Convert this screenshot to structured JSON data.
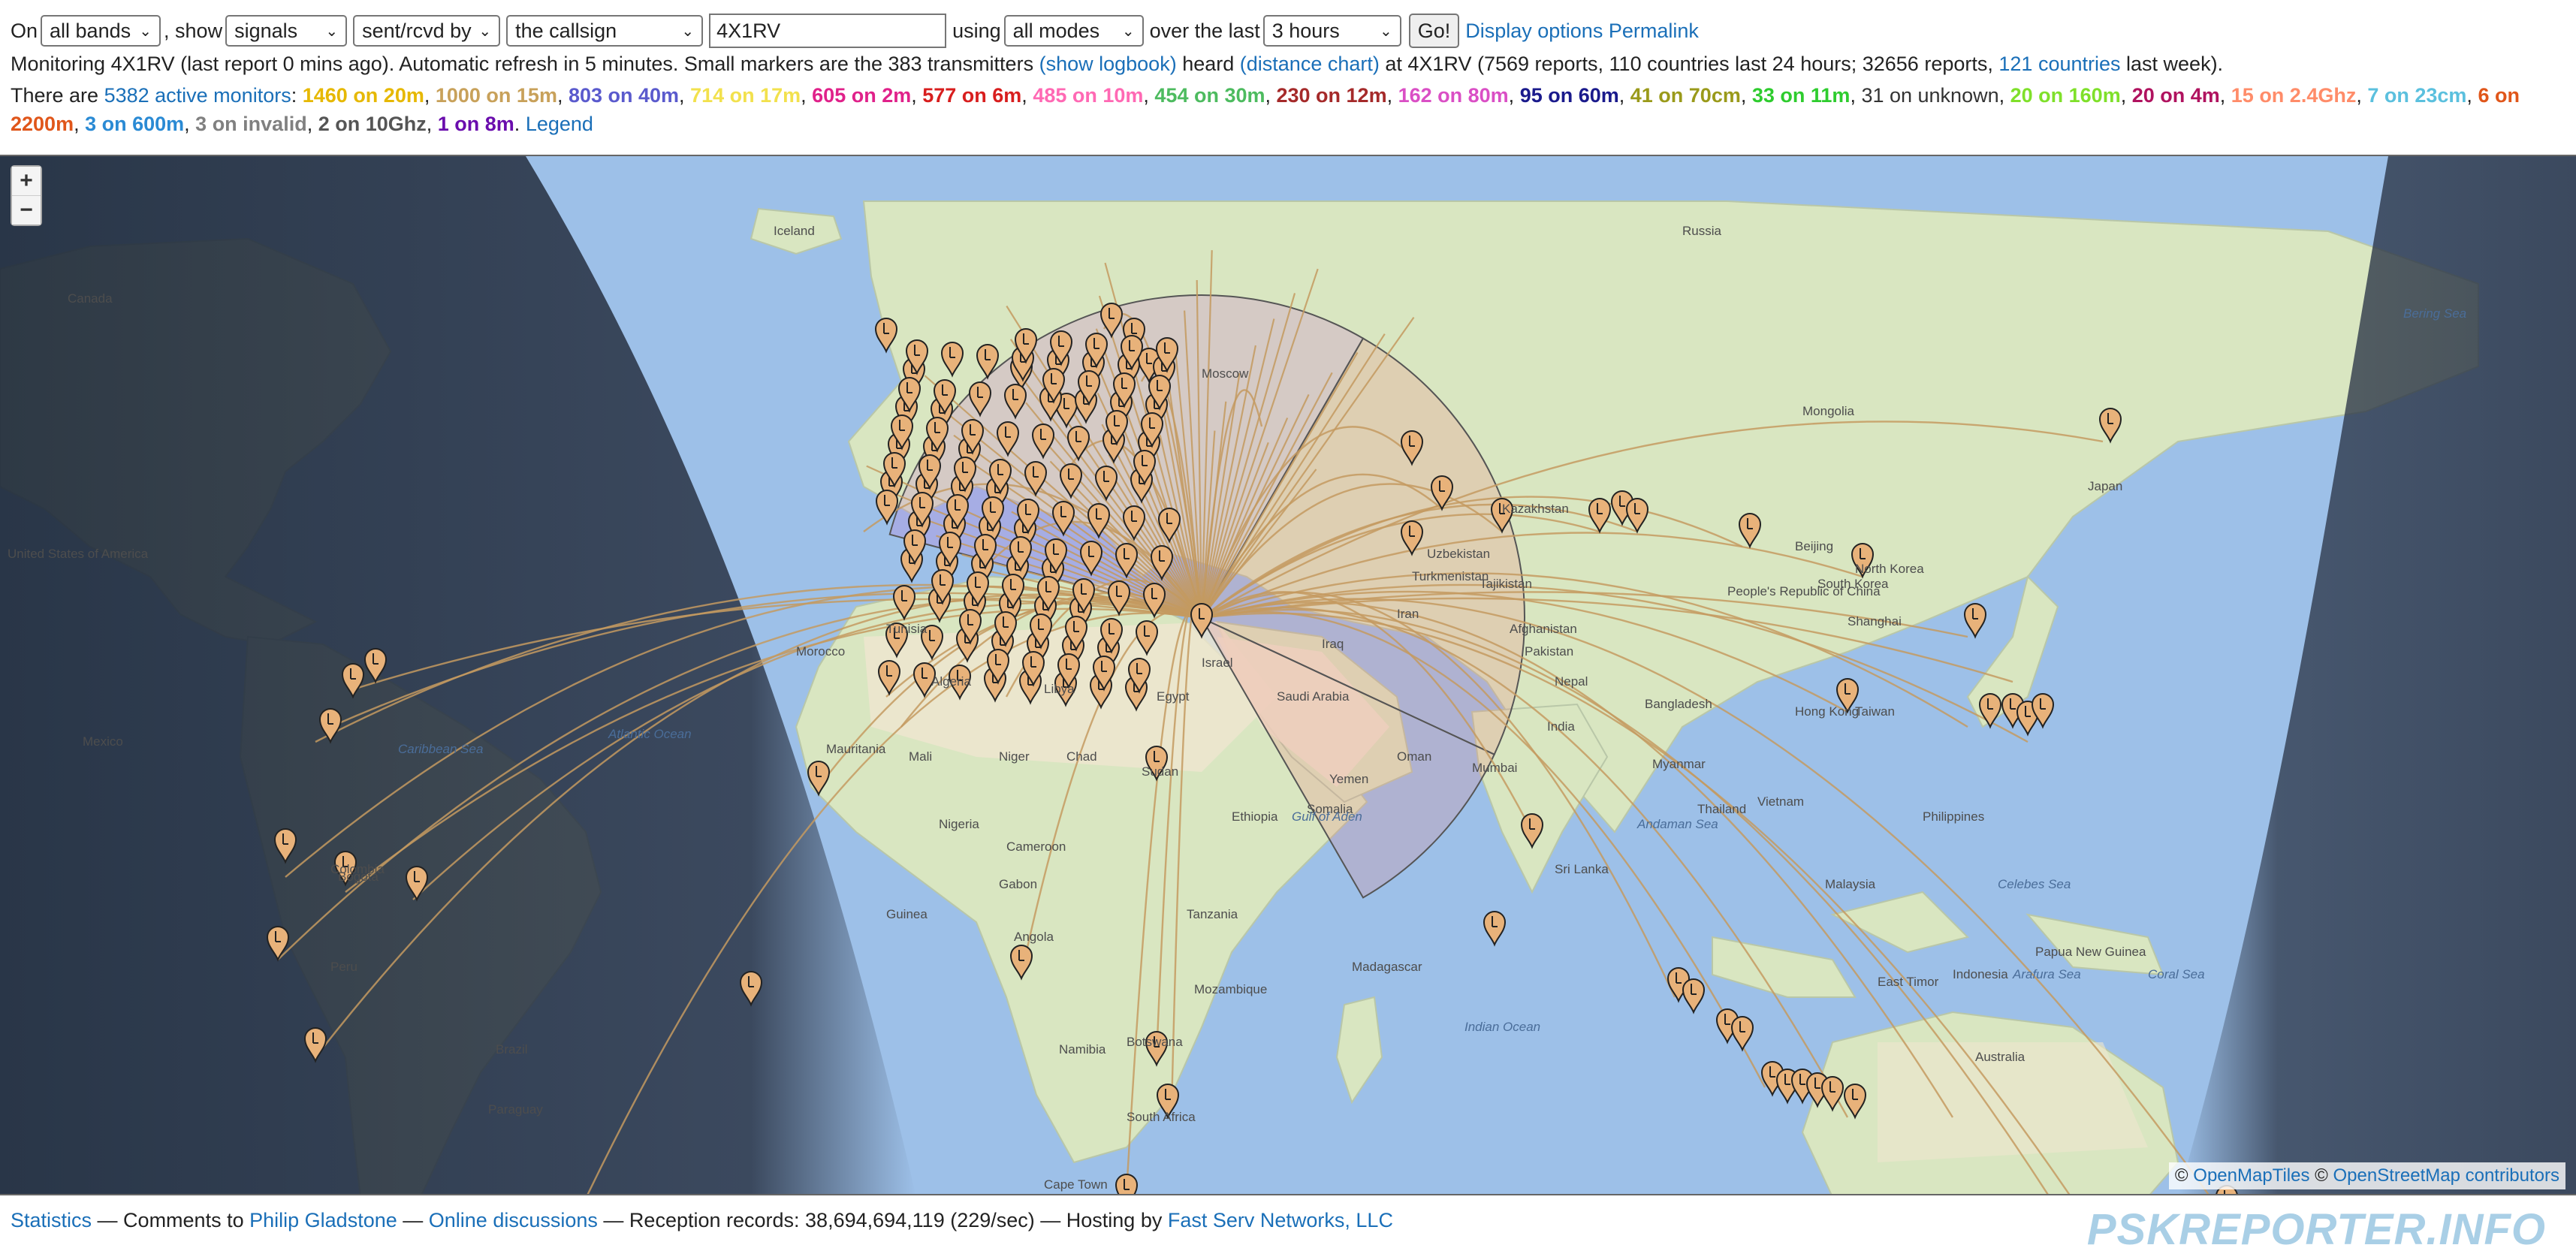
{
  "controls": {
    "on_label": "On",
    "band": "all bands",
    "show_label": ", show",
    "show": "signals",
    "direction": "sent/rcvd by",
    "target": "the callsign",
    "callsign": "4X1RV",
    "using_label": "using",
    "mode": "all modes",
    "over_label": "over the last",
    "period": "3 hours",
    "go": "Go!",
    "display_options": "Display options",
    "permalink": "Permalink"
  },
  "status": {
    "line1_a": "Monitoring 4X1RV (last report 0 mins ago). Automatic refresh in 5 minutes. Small markers are the 383 transmitters",
    "show_logbook": "(show logbook)",
    "heard": "heard",
    "distance_chart": "(distance chart)",
    "line1_b": "at 4X1RV (7569 reports, 110 countries last 24 hours; 32656 reports,",
    "countries_link": "121 countries",
    "line1_c": "last week).",
    "there_are": "There are",
    "active_monitors": "5382 active monitors",
    "colon": ":",
    "legend": "Legend"
  },
  "bands": [
    {
      "text": "1460 on 20m",
      "color": "#e6b800"
    },
    {
      "text": "1000 on 15m",
      "color": "#c8a15a"
    },
    {
      "text": "803 on 40m",
      "color": "#5a5acd"
    },
    {
      "text": "714 on 17m",
      "color": "#f2e14d"
    },
    {
      "text": "605 on 2m",
      "color": "#e0218a"
    },
    {
      "text": "577 on 6m",
      "color": "#d81e1e"
    },
    {
      "text": "485 on 10m",
      "color": "#ff69b4"
    },
    {
      "text": "454 on 30m",
      "color": "#4dbb5f"
    },
    {
      "text": "230 on 12m",
      "color": "#a52a2a"
    },
    {
      "text": "162 on 80m",
      "color": "#da4fc5"
    },
    {
      "text": "95 on 60m",
      "color": "#1a1a8c"
    },
    {
      "text": "41 on 70cm",
      "color": "#9a9a1a"
    },
    {
      "text": "33 on 11m",
      "color": "#2ecc2e"
    },
    {
      "text": "31 on unknown",
      "color": "#333333"
    },
    {
      "text": "20 on 160m",
      "color": "#7fe02a"
    },
    {
      "text": "20 on 4m",
      "color": "#b0125f"
    },
    {
      "text": "15 on 2.4Ghz",
      "color": "#ff8c69"
    },
    {
      "text": "7 on 23cm",
      "color": "#5bc0de"
    },
    {
      "text": "6 on 2200m",
      "color": "#e0561a"
    },
    {
      "text": "3 on 600m",
      "color": "#2a8ad4"
    },
    {
      "text": "3 on invalid",
      "color": "#808080"
    },
    {
      "text": "2 on 10Ghz",
      "color": "#555555"
    },
    {
      "text": "1 on 8m",
      "color": "#6a0dad"
    }
  ],
  "map": {
    "zoom_in": "+",
    "zoom_out": "−",
    "attribution_prefix": "©",
    "openmaptiles": "OpenMapTiles",
    "openstreetmap": "OpenStreetMap contributors",
    "labels": [
      "Iceland",
      "Russia",
      "Canada",
      "Bering Sea",
      "Moscow",
      "Kazakhstan",
      "Mongolia",
      "United States of America",
      "North Korea",
      "South Korea",
      "Beijing",
      "Shanghai",
      "People's Republic of China",
      "Hong Kong",
      "Taiwan",
      "Japan",
      "Algeria",
      "Libya",
      "Egypt",
      "Saudi Arabia",
      "Mauritania",
      "Mali",
      "Niger",
      "Chad",
      "Sudan",
      "Ethiopia",
      "Somalia",
      "Nigeria",
      "Cameroon",
      "Gabon",
      "Angola",
      "Tanzania",
      "Mozambique",
      "Madagascar",
      "Namibia",
      "Botswana",
      "South Africa",
      "Cape Town",
      "India",
      "Mumbai",
      "Nepal",
      "Bangladesh",
      "Myanmar",
      "Thailand",
      "Vietnam",
      "Philippines",
      "Malaysia",
      "Indonesia",
      "Australia",
      "Papua New Guinea",
      "East Timor",
      "Sri Lanka",
      "Mexico",
      "Colombia",
      "Bogota",
      "Peru",
      "Brazil",
      "Paraguay",
      "Uzbekistan",
      "Turkmenistan",
      "Tajikistan",
      "Afghanistan",
      "Pakistan",
      "Iran",
      "Iraq",
      "Israel",
      "Yemen",
      "Oman",
      "Morocco",
      "Tunisia",
      "Atlantic Ocean",
      "Indian Ocean",
      "Arafura Sea",
      "Coral Sea",
      "Celebes Sea",
      "Gulf of Aden",
      "Andaman Sea",
      "Caribbean Sea",
      "Guinea"
    ]
  },
  "footer": {
    "statistics": "Statistics",
    "sep1": "— Comments to",
    "author": "Philip Gladstone",
    "sep2": "—",
    "discussions": "Online discussions",
    "records": "— Reception records: 38,694,694,119 (229/sec) — Hosting by",
    "hosting": "Fast Serv Networks, LLC",
    "logo": "PSKREPORTER.INFO"
  }
}
